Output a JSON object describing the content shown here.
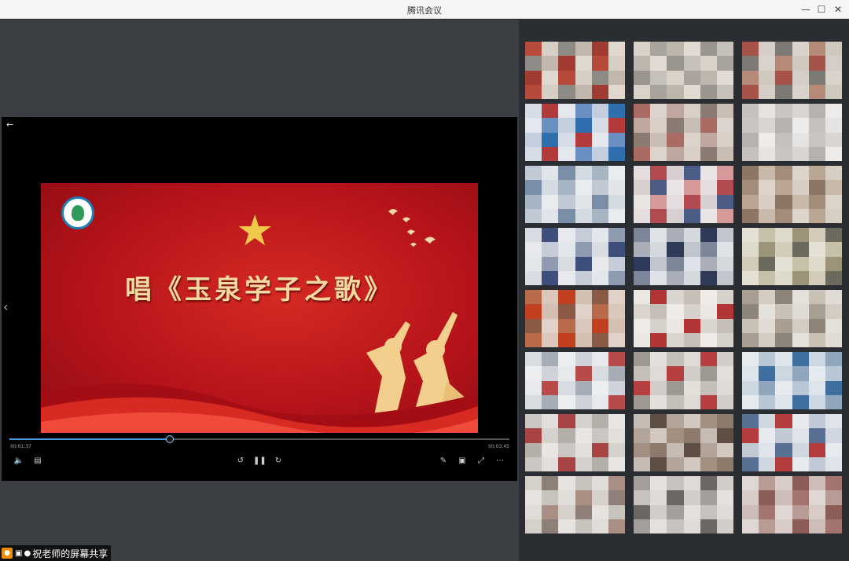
{
  "window": {
    "title": "腾讯会议"
  },
  "player": {
    "slide_title": "唱《玉泉学子之歌》",
    "time_current": "00:01:37",
    "time_total": "00:03:45",
    "progress": 0.32
  },
  "share_label": {
    "text": "祝老师的屏幕共享"
  },
  "gallery": {
    "tiles": [
      [
        "#b84a3c",
        "#d8cfc4",
        "#8e8a86",
        "#c2b7ac",
        "#a13c33",
        "#e0d8cf"
      ],
      [
        "#c5c1b8",
        "#d8d2c8",
        "#a8a39c",
        "#bdb6ad",
        "#e1dbd4",
        "#9a958f"
      ],
      [
        "#b68a78",
        "#cfc8bf",
        "#a6544a",
        "#d5cec6",
        "#7d7a76",
        "#d9d3cc"
      ],
      [
        "#6a90c2",
        "#c3cfde",
        "#2f6fae",
        "#d6dde6",
        "#b23a3a",
        "#e4e8ee"
      ],
      [
        "#bfa7a0",
        "#d9cfc7",
        "#8a7b73",
        "#c9bdb4",
        "#a96b63",
        "#dcd4cc"
      ],
      [
        "#e6e4e2",
        "#c9c5c2",
        "#d9d5d1",
        "#b8b2ae",
        "#eeeceb",
        "#c7c1bd"
      ],
      [
        "#c0c9d4",
        "#e1e5ea",
        "#7a8ea8",
        "#d5dbe2",
        "#a7b4c4",
        "#e8ecef"
      ],
      [
        "#d49a9a",
        "#e6dede",
        "#b24a52",
        "#d8cfd1",
        "#4d5c84",
        "#e9e5e4"
      ],
      [
        "#bba694",
        "#d7cec4",
        "#8d7666",
        "#c8b9ab",
        "#a48c7a",
        "#ddd4cb"
      ],
      [
        "#c5ccd7",
        "#e3e6ea",
        "#8f9bb0",
        "#d9dde3",
        "#3d4f7a",
        "#e7e9ec"
      ],
      [
        "#a9aeb8",
        "#d5d8dc",
        "#2f3a58",
        "#c1c6ce",
        "#7d8699",
        "#dfe2e6"
      ],
      [
        "#c6c0a8",
        "#dfdbcc",
        "#9c9478",
        "#d2ccb8",
        "#6b6a5c",
        "#e4e0d4"
      ],
      [
        "#b86a4a",
        "#d9c7bb",
        "#c2401f",
        "#d4c0b3",
        "#8a5a44",
        "#e0d2c8"
      ],
      [
        "#d7d1cb",
        "#ebe7e3",
        "#b23535",
        "#dbd5cf",
        "#c7bfb7",
        "#eeebe8"
      ],
      [
        "#c9c1b6",
        "#e0dbd4",
        "#a89e91",
        "#d3ccc3",
        "#8e857a",
        "#e4e0da"
      ],
      [
        "#cfd3d9",
        "#e7e9ec",
        "#b94a4a",
        "#d8dce0",
        "#a7adb6",
        "#eceef0"
      ],
      [
        "#c4bfb9",
        "#dedad6",
        "#b63f3f",
        "#d2cdc8",
        "#9e9892",
        "#e3e0dc"
      ],
      [
        "#b8c7d6",
        "#dde4eb",
        "#3f6f9e",
        "#ccd7e1",
        "#8fa6bd",
        "#e5eaef"
      ],
      [
        "#cbc6c2",
        "#e2dfdc",
        "#a94444",
        "#d5d1cd",
        "#b5afaa",
        "#e8e5e3"
      ],
      [
        "#8d7a6c",
        "#c7bcb3",
        "#5f4e43",
        "#b3a59a",
        "#d2c8c0",
        "#a28f82"
      ],
      [
        "#c1c9d4",
        "#dfe4ea",
        "#5a6f94",
        "#d0d7e0",
        "#b43c3c",
        "#e7eaee"
      ],
      [
        "#c9c3bd",
        "#e0dcd8",
        "#a98e84",
        "#d6d0cb",
        "#8e8078",
        "#e5e2df"
      ],
      [
        "#c7c2bd",
        "#dedbd8",
        "#6b6864",
        "#d2cdc9",
        "#a49f9a",
        "#e3e0dd"
      ],
      [
        "#b89b95",
        "#d9ccc8",
        "#8c5c57",
        "#cdbdb8",
        "#a3746e",
        "#e0d6d3"
      ]
    ]
  }
}
